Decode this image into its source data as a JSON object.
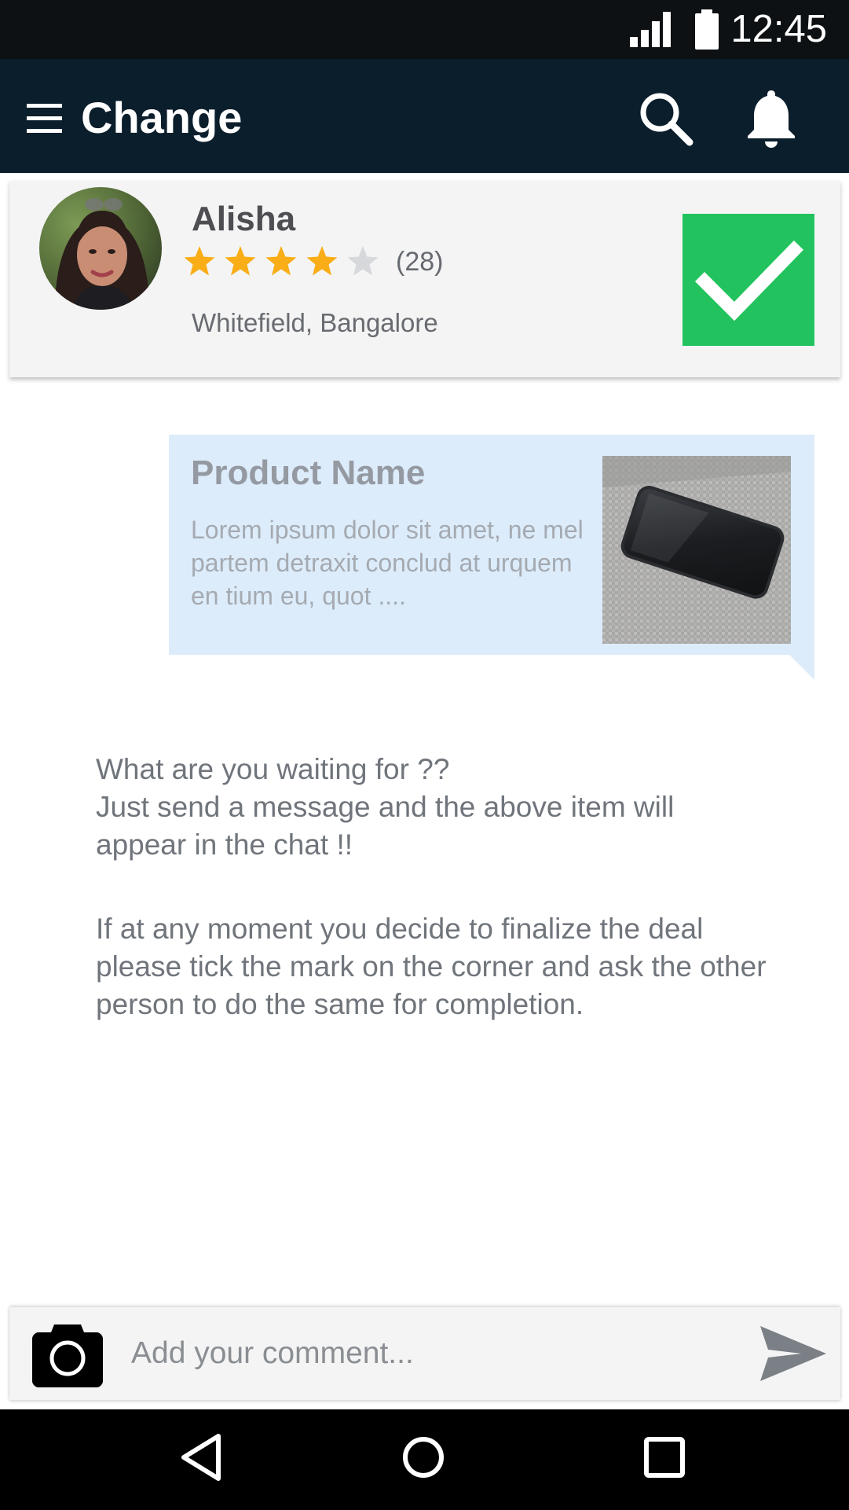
{
  "status_bar": {
    "time": "12:45",
    "signal_icon": "signal-icon",
    "battery_icon": "battery-icon"
  },
  "app_bar": {
    "title": "Change",
    "menu_icon": "menu-icon",
    "search_icon": "search-icon",
    "notification_icon": "bell-icon",
    "background": "#0b1e2c"
  },
  "profile": {
    "name": "Alisha",
    "rating": 4,
    "rating_max": 5,
    "rating_count": "(28)",
    "location": "Whitefield, Bangalore",
    "confirm_icon": "checkmark-icon",
    "confirm_color": "#22c35e"
  },
  "product": {
    "title": "Product Name",
    "description": "Lorem ipsum dolor sit amet, ne mel partem detraxit conclud at urquem en tium eu, quot ....",
    "bubble_color": "#dcecfb"
  },
  "instructions": {
    "line1": "What are you waiting for ??",
    "line2": "Just send a message and the above item will appear in the chat !!",
    "paragraph2": "If at any moment you decide to finalize the deal please tick the mark on the corner and ask the other person to do the same for completion."
  },
  "comment": {
    "placeholder": "Add your comment...",
    "camera_icon": "camera-icon",
    "send_icon": "send-icon"
  },
  "nav": {
    "back_icon": "back-icon",
    "home_icon": "home-icon",
    "recents_icon": "recents-icon"
  },
  "colors": {
    "star_filled": "#f9ad17",
    "star_empty": "#d6d8db"
  }
}
